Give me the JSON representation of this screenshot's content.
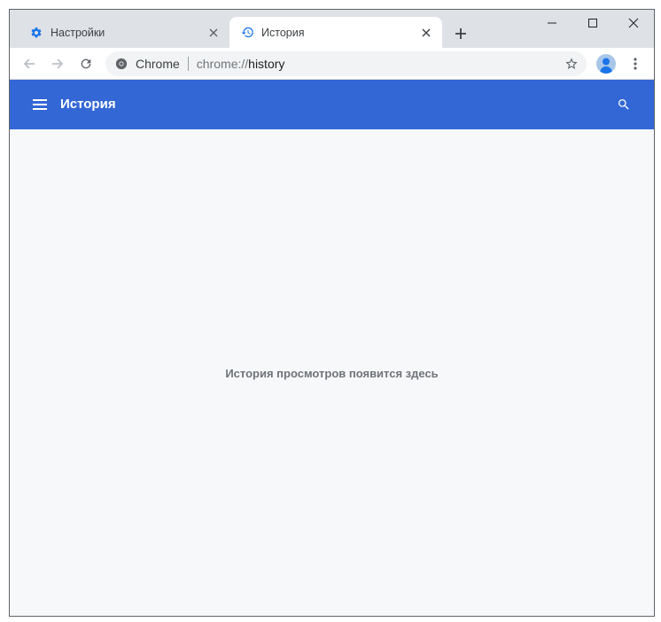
{
  "tabs": [
    {
      "title": "Настройки",
      "icon": "gear-icon",
      "active": false
    },
    {
      "title": "История",
      "icon": "history-icon",
      "active": true
    }
  ],
  "toolbar": {
    "chip_label": "Chrome",
    "url_scheme": "chrome://",
    "url_host": "history"
  },
  "app": {
    "title": "История",
    "empty_message": "История просмотров появится здесь"
  },
  "colors": {
    "header": "#3367d6",
    "tabstrip": "#dee1e6",
    "content": "#f7f8fa"
  }
}
